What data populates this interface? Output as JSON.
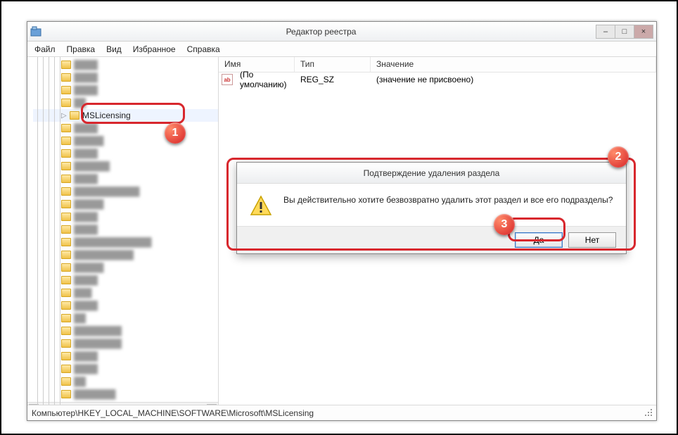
{
  "window": {
    "title": "Редактор реестра",
    "minimize": "–",
    "maximize": "□",
    "close": "×"
  },
  "menu": {
    "file": "Файл",
    "edit": "Правка",
    "view": "Вид",
    "favorites": "Избранное",
    "help": "Справка"
  },
  "tree": {
    "selected_key": "MSLicensing"
  },
  "list": {
    "columns": {
      "name": "Имя",
      "type": "Тип",
      "value": "Значение"
    },
    "row0": {
      "icon": "ab",
      "name": "(По умолчанию)",
      "type": "REG_SZ",
      "value": "(значение не присвоено)"
    }
  },
  "statusbar": {
    "path": "Компьютер\\HKEY_LOCAL_MACHINE\\SOFTWARE\\Microsoft\\MSLicensing"
  },
  "dialog": {
    "title": "Подтверждение удаления раздела",
    "message": "Вы действительно хотите безвозвратно удалить этот раздел и все его подразделы?",
    "yes": "Да",
    "no": "Нет"
  },
  "annotations": {
    "b1": "1",
    "b2": "2",
    "b3": "3"
  }
}
